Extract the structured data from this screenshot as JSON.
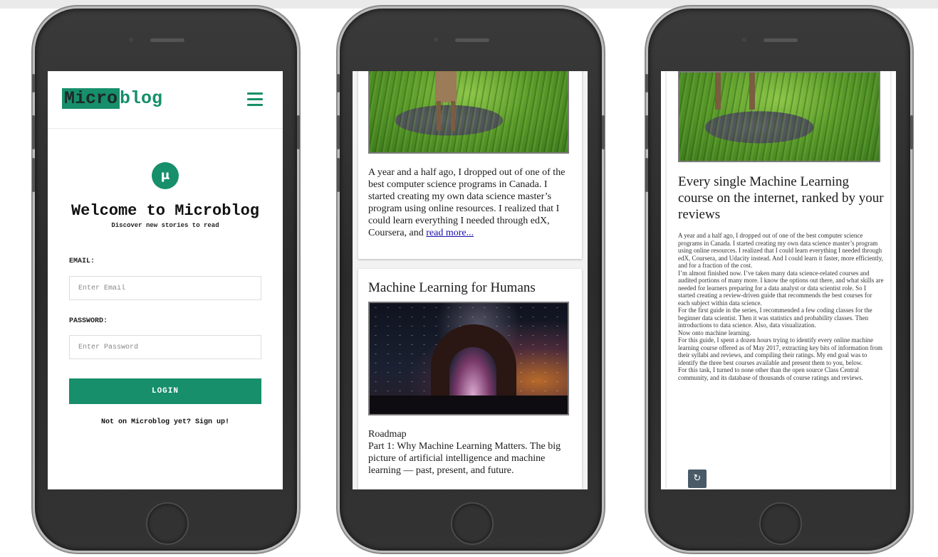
{
  "login": {
    "logo_micro": "Micro",
    "logo_blog": "blog",
    "mu_icon": "µ",
    "title": "Welcome to Microblog",
    "subtitle": "Discover new stories to read",
    "email_label": "EMAIL:",
    "email_placeholder": "Enter Email",
    "password_label": "PASSWORD:",
    "password_placeholder": "Enter Password",
    "login_button": "LOGIN",
    "signup_text": "Not on Microblog yet? Sign up!"
  },
  "feed": {
    "excerpt_text": "A year and a half ago, I dropped out of one of the best computer science programs in Canada. I started creating my own data science master’s program using online resources. I realized that I could learn everything I needed through edX, Coursera, and ",
    "read_more": "read more...",
    "card2_title": "Machine Learning for Humans",
    "roadmap_lines": [
      "Roadmap",
      "Part 1: Why Machine Learning Matters. The big picture of artificial intelligence and machine learning — past, present, and future."
    ]
  },
  "article": {
    "title": "Every single Machine Learning course on the internet, ranked by your reviews",
    "paragraphs": [
      "A year and a half ago, I dropped out of one of the best computer science programs in Canada. I started creating my own data science master’s program using online resources. I realized that I could learn everything I needed through edX, Coursera, and Udacity instead. And I could learn it faster, more efficiently, and for a fraction of the cost.",
      "I’m almost finished now. I’ve taken many data science-related courses and audited portions of many more. I know the options out there, and what skills are needed for learners preparing for a data analyst or data scientist role. So I started creating a review-driven guide that recommends the best courses for each subject within data science.",
      "For the first guide in the series, I recommended a few coding classes for the beginner data scientist. Then it was statistics and probability classes. Then introductions to data science. Also, data visualization.",
      "Now onto machine learning.",
      "For this guide, I spent a dozen hours trying to identify every online machine learning course offered as of May 2017, extracting key bits of information from their syllabi and reviews, and compiling their ratings. My end goal was to identify the three best courses available and present them to you, below.",
      "For this task, I turned to none other than the open source Class Central community, and its database of thousands of course ratings and reviews."
    ],
    "undo_icon": "↻"
  },
  "colors": {
    "brand": "#168f6a",
    "link": "#1a0dab",
    "undo_button": "#4a5a66"
  }
}
